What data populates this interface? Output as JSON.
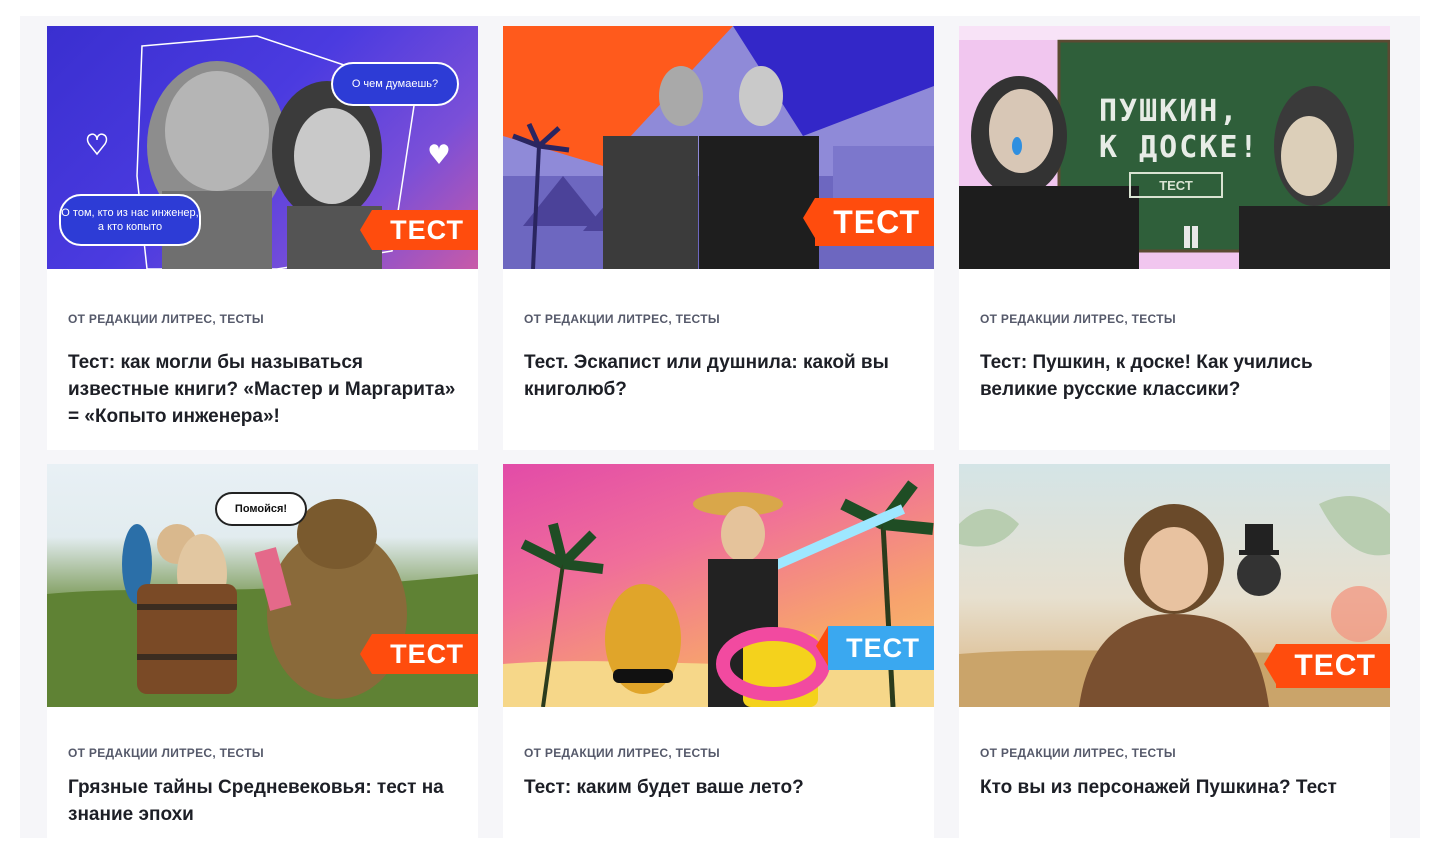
{
  "cards": [
    {
      "meta": "ОТ РЕДАКЦИИ ЛИТРЕС, ТЕСТЫ",
      "title": "Тест: как могли бы называться известные книги? «Мастер и Маргарита» = «Копыто инженера»!",
      "badge": "ТЕСТ",
      "bubble_top": "О чем думаешь?",
      "bubble_bottom": "О том, кто из нас инженер, а кто копыто"
    },
    {
      "meta": "ОТ РЕДАКЦИИ ЛИТРЕС, ТЕСТЫ",
      "title": "Тест. Эскапист или душнила: какой вы книголюб?",
      "badge": "ТЕСТ"
    },
    {
      "meta": "ОТ РЕДАКЦИИ ЛИТРЕС, ТЕСТЫ",
      "title": "Тест: Пушкин, к доске! Как учились великие русские классики?",
      "board_line1": "ПУШКИН,",
      "board_line2": "К ДОСКЕ!",
      "board_stamp": "ТЕСТ"
    },
    {
      "meta": "ОТ РЕДАКЦИИ ЛИТРЕС, ТЕСТЫ",
      "title": "Грязные тайны Средневековья: тест на знание эпохи",
      "badge": "ТЕСТ",
      "speech": "Помойся!",
      "soap": "SOAP"
    },
    {
      "meta": "ОТ РЕДАКЦИИ ЛИТРЕС, ТЕСТЫ",
      "title": "Тест: каким будет ваше лето?",
      "badge": "ТЕСТ"
    },
    {
      "meta": "ОТ РЕДАКЦИИ ЛИТРЕС, ТЕСТЫ",
      "title": "Кто вы из персонажей Пушкина? Тест",
      "badge": "ТЕСТ"
    }
  ],
  "colors": {
    "accent": "#ff4c0d",
    "badge_light": "#3aa8f0",
    "page_bg": "#f6f6f9",
    "title": "#1d1f26",
    "meta": "#55596a"
  }
}
